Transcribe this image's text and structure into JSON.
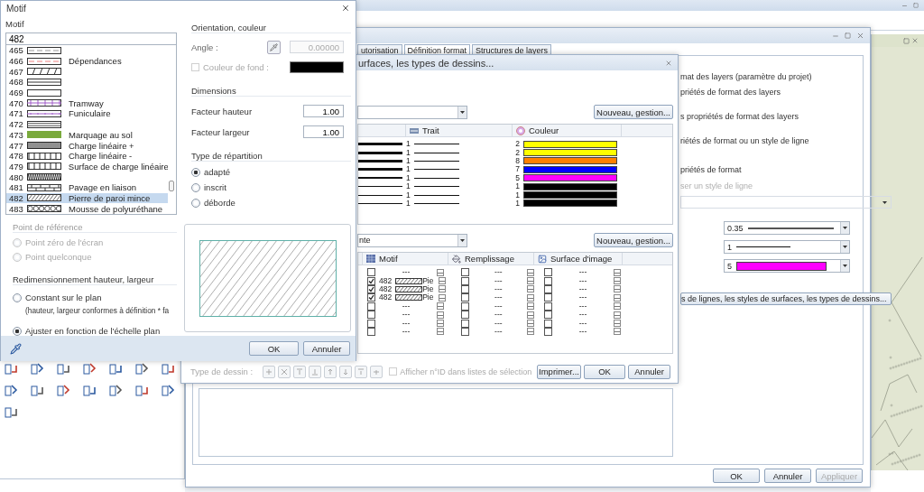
{
  "motif_dialog": {
    "title": "Motif",
    "list_label": "Motif",
    "search": {
      "value": "482"
    },
    "patterns": [
      {
        "number": "465",
        "kind": "dash",
        "selected": false
      },
      {
        "number": "466",
        "kind": "dash-red",
        "name": "Dépendances",
        "selected": false
      },
      {
        "number": "467",
        "kind": "slash",
        "selected": false
      },
      {
        "number": "468",
        "kind": "double",
        "selected": false
      },
      {
        "number": "469",
        "kind": "empty",
        "selected": false
      },
      {
        "number": "470",
        "kind": "rail",
        "name": "Tramway",
        "selected": false
      },
      {
        "number": "471",
        "kind": "rail-dot",
        "name": "Funiculaire",
        "selected": false
      },
      {
        "number": "472",
        "kind": "triple",
        "selected": false
      },
      {
        "number": "473",
        "kind": "solid-green",
        "name": "Marquage au sol",
        "selected": false
      },
      {
        "number": "477",
        "kind": "dense",
        "name": "Charge linéaire +",
        "selected": false
      },
      {
        "number": "478",
        "kind": "ticks",
        "name": "Charge linéaire -",
        "selected": false
      },
      {
        "number": "479",
        "kind": "ticks",
        "name": "Surface de charge linéaire",
        "selected": false
      },
      {
        "number": "480",
        "kind": "diagonal",
        "selected": false
      },
      {
        "number": "481",
        "kind": "brick",
        "name": "Pavage en liaison",
        "selected": false
      },
      {
        "number": "482",
        "kind": "hatch",
        "name": "Pierre de paroi mince",
        "selected": true
      },
      {
        "number": "483",
        "kind": "circles",
        "name": "Mousse de polyuréthane",
        "selected": false
      }
    ],
    "reference_point": {
      "title": "Point de référence",
      "disabled": true,
      "options": [
        {
          "label": "Point zéro de l'écran",
          "selected": false
        },
        {
          "label": "Point quelconque",
          "selected": false
        }
      ]
    },
    "resize": {
      "title": "Redimensionnement hauteur, largeur",
      "options": [
        {
          "label": "Constant sur le plan",
          "note": "(hauteur, largeur conformes à définition * fa",
          "selected": false
        },
        {
          "label": "Ajuster en fonction de l'échelle plan",
          "selected": true
        }
      ]
    },
    "orientation": {
      "title": "Orientation, couleur",
      "angle_label": "Angle :",
      "angle_value": "0.00000",
      "angle_disabled": true,
      "background": {
        "label": "Couleur de fond :",
        "checked": false,
        "disabled": true
      }
    },
    "dimensions": {
      "title": "Dimensions",
      "fields": [
        {
          "label": "Facteur hauteur",
          "value": "1.00"
        },
        {
          "label": "Facteur largeur",
          "value": "1.00"
        }
      ]
    },
    "distribution": {
      "title": "Type de répartition",
      "options": [
        {
          "label": "adapté",
          "selected": true
        },
        {
          "label": "inscrit",
          "selected": false
        },
        {
          "label": "déborde",
          "selected": false
        }
      ]
    },
    "buttons": [
      "OK",
      "Annuler"
    ]
  },
  "styles_dialog": {
    "title": "urfaces, les types de dessins...",
    "new_button": "Nouveau, gestion...",
    "line_table": {
      "columns": [
        "Trait",
        "Couleur"
      ],
      "rows": [
        {
          "kind": "heavy",
          "trait": "1",
          "color_number": "2",
          "color": "#ffff00"
        },
        {
          "kind": "heavy",
          "trait": "1",
          "color_number": "2",
          "color": "#ffff00"
        },
        {
          "kind": "heavy",
          "trait": "1",
          "color_number": "8",
          "color": "#ff8000"
        },
        {
          "kind": "heavy",
          "trait": "1",
          "color_number": "7",
          "color": "#0000ff"
        },
        {
          "kind": "medium",
          "trait": "1",
          "color_number": "5",
          "color": "#ff00ff"
        },
        {
          "kind": "light",
          "trait": "1",
          "color_number": "1",
          "color": "#000000"
        },
        {
          "kind": "light",
          "trait": "1",
          "color_number": "1",
          "color": "#000000"
        },
        {
          "kind": "light",
          "trait": "1",
          "color_number": "1",
          "color": "#000000"
        }
      ]
    },
    "surface_select": {
      "value": "nte"
    },
    "new_button_2": "Nouveau, gestion...",
    "surface_table": {
      "columns": [
        "Motif",
        "Remplissage",
        "Surface d'image"
      ],
      "rows": [
        {
          "checked": false,
          "kind": "none",
          "motif": "---",
          "fill_checked": false,
          "fill": "---",
          "image_checked": false,
          "image": "---"
        },
        {
          "checked": true,
          "kind": "pattern",
          "number": "482",
          "name": "Pie",
          "fill_checked": false,
          "fill": "---",
          "image_checked": false,
          "image": "---"
        },
        {
          "checked": true,
          "kind": "pattern",
          "number": "482",
          "name": "Pie",
          "fill_checked": false,
          "fill": "---",
          "image_checked": false,
          "image": "---"
        },
        {
          "checked": true,
          "kind": "pattern",
          "number": "482",
          "name": "Pie",
          "fill_checked": false,
          "fill": "---",
          "image_checked": false,
          "image": "---"
        },
        {
          "checked": false,
          "kind": "none",
          "motif": "---",
          "fill_checked": false,
          "fill": "---",
          "image_checked": false,
          "image": "---"
        },
        {
          "checked": false,
          "kind": "none",
          "motif": "---",
          "fill_checked": false,
          "fill": "---",
          "image_checked": false,
          "image": "---"
        },
        {
          "checked": false,
          "kind": "none",
          "motif": "---",
          "fill_checked": false,
          "fill": "---",
          "image_checked": false,
          "image": "---"
        },
        {
          "checked": false,
          "kind": "none",
          "motif": "---",
          "fill_checked": false,
          "fill": "---",
          "image_checked": false,
          "image": "---"
        }
      ]
    },
    "drawing_type_label": "Type de dessin :",
    "show_id": {
      "label": "Afficher n°ID dans listes de sélection",
      "checked": false,
      "disabled": true
    },
    "buttons": [
      "Imprimer...",
      "OK",
      "Annuler"
    ]
  },
  "layers_dialog": {
    "tabs": [
      {
        "label": "utorisation",
        "selected": false
      },
      {
        "label": "Définition format",
        "selected": true
      },
      {
        "label": "Structures de layers",
        "selected": false
      }
    ],
    "section_title": "mat des layers (paramètre du projet)",
    "options": [
      "priétés de format des layers",
      "s propriétés de format des layers",
      "riétés de format ou un style de ligne"
    ],
    "format_title": "priétés de format",
    "line_style_option": {
      "label": "ser un style de ligne",
      "disabled": true
    },
    "format_fields": [
      {
        "kind": "pen",
        "value": "0.35"
      },
      {
        "kind": "line",
        "value": "1"
      },
      {
        "kind": "color",
        "value": "5",
        "color": "#ff00ff"
      }
    ],
    "manage_button": "s de lignes, les styles de surfaces, les types de dessins...",
    "buttons": [
      {
        "label": "OK",
        "disabled": false
      },
      {
        "label": "Annuler",
        "disabled": false
      },
      {
        "label": "Appliquer",
        "disabled": true
      }
    ]
  }
}
